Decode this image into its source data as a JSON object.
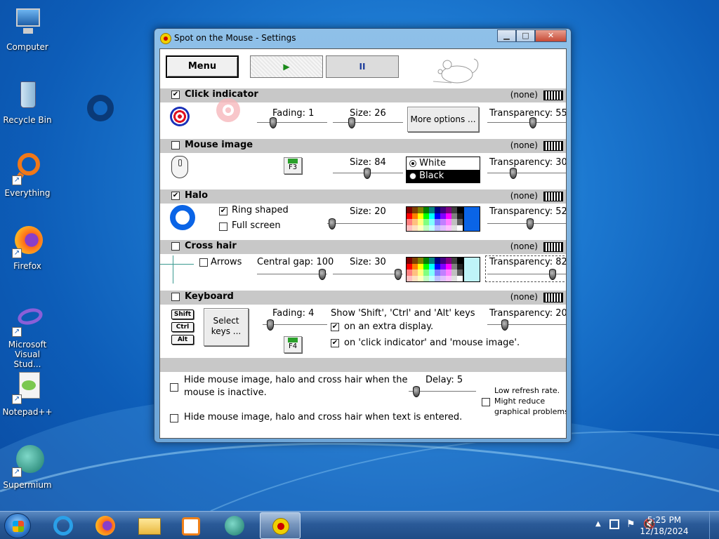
{
  "desktop": {
    "icons": [
      {
        "label": "Computer"
      },
      {
        "label": "Recycle Bin"
      },
      {
        "label": "Everything"
      },
      {
        "label": "Firefox"
      },
      {
        "label": "Microsoft Visual Stud..."
      },
      {
        "label": "Notepad++"
      },
      {
        "label": "Supermium"
      }
    ]
  },
  "window": {
    "title": "Spot on the Mouse - Settings",
    "menu_label": "Menu",
    "play_symbol": "▶",
    "pause_symbol": "II"
  },
  "click_indicator": {
    "label": "Click indicator",
    "checked": true,
    "hotkey": "(none)",
    "fading_label": "Fading: 1",
    "fading_value": 1,
    "size_label": "Size: 26",
    "size_value": 26,
    "more_options": "More options ...",
    "transparency_label": "Transparency: 55",
    "transparency_value": 55
  },
  "mouse_image": {
    "label": "Mouse image",
    "checked": false,
    "hotkey": "(none)",
    "fkey": "F3",
    "size_label": "Size: 84",
    "size_value": 84,
    "option_white": "White",
    "option_black": "Black",
    "transparency_label": "Transparency: 30",
    "transparency_value": 30
  },
  "halo": {
    "label": "Halo",
    "checked": true,
    "hotkey": "(none)",
    "ring_shaped": "Ring shaped",
    "ring_checked": true,
    "full_screen": "Full screen",
    "full_checked": false,
    "size_label": "Size: 20",
    "size_value": 20,
    "selected_color": "#0a64e6",
    "transparency_label": "Transparency: 52",
    "transparency_value": 52
  },
  "cross_hair": {
    "label": "Cross hair",
    "checked": false,
    "hotkey": "(none)",
    "arrows": "Arrows",
    "gap_label": "Central gap: 100",
    "gap_value": 100,
    "size_label": "Size: 30",
    "size_value": 30,
    "selected_color": "#bff4f8",
    "transparency_label": "Transparency: 82",
    "transparency_value": 82
  },
  "keyboard": {
    "label": "Keyboard",
    "checked": false,
    "hotkey": "(none)",
    "keys": [
      "Shift",
      "Ctrl",
      "Alt"
    ],
    "select_keys_1": "Select",
    "select_keys_2": "keys ...",
    "fading_label": "Fading: 4",
    "fading_value": 4,
    "fkey": "F4",
    "show_keys": "Show 'Shift', 'Ctrl' and 'Alt' keys",
    "extra_display": "on an extra display.",
    "on_click": "on 'click indicator' and 'mouse image'.",
    "transparency_label": "Transparency: 20",
    "transparency_value": 20
  },
  "bottom": {
    "hide_inactive_1": "Hide mouse image, halo and cross hair when the",
    "hide_inactive_2": "mouse is inactive.",
    "delay_label": "Delay: 5",
    "delay_value": 5,
    "low_refresh_1": "Low refresh rate.",
    "low_refresh_2": "Might reduce",
    "low_refresh_3": "graphical problems.",
    "hide_text": "Hide mouse image, halo and cross hair when text is entered."
  },
  "taskbar": {
    "time": "5:25 PM",
    "date": "12/18/2024"
  }
}
